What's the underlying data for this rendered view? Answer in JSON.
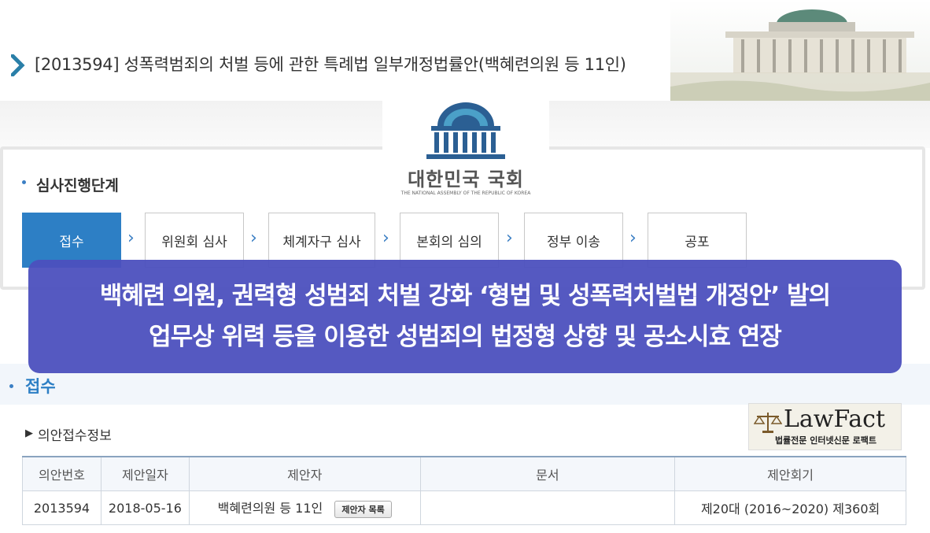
{
  "bill": {
    "title": "[2013594] 성폭력범죄의 처벌 등에 관한 특례법 일부개정법률안(백혜련의원 등 11인)"
  },
  "logo": {
    "name": "대한민국 국회",
    "subtitle": "THE NATIONAL ASSEMBLY OF THE REPUBLIC OF KOREA"
  },
  "stages": {
    "section_label": "심사진행단계",
    "steps": [
      {
        "label": "접수",
        "active": true
      },
      {
        "label": "위원회 심사",
        "active": false
      },
      {
        "label": "체계자구 심사",
        "active": false
      },
      {
        "label": "본회의 심의",
        "active": false
      },
      {
        "label": "정부 이송",
        "active": false
      },
      {
        "label": "공포",
        "active": false
      }
    ],
    "arrow": "›"
  },
  "banner": {
    "line1": "백혜련 의원, 권력형 성범죄 처벌 강화 ‘형법 및 성폭력처벌법 개정안’ 발의",
    "line2": "업무상 위력 등을 이용한 성범죄의 법정형 상향 및 공소시효 연장"
  },
  "receipt": {
    "title": "접수",
    "info_title": "의안접수정보",
    "info_arrow": "▶",
    "columns": [
      "의안번호",
      "제안일자",
      "제안자",
      "문서",
      "제안회기"
    ],
    "row": {
      "bill_no": "2013594",
      "date": "2018-05-16",
      "proposer": "백혜련의원 등 11인",
      "proposer_button": "제안자 목록",
      "document": "",
      "session": "제20대 (2016~2020) 제360회"
    }
  },
  "watermark": {
    "name": "LawFact",
    "subtitle": "법률전문 인터넷신문 로팩트"
  },
  "colors": {
    "accent": "#2d7fc5",
    "banner": "#4c50be"
  }
}
